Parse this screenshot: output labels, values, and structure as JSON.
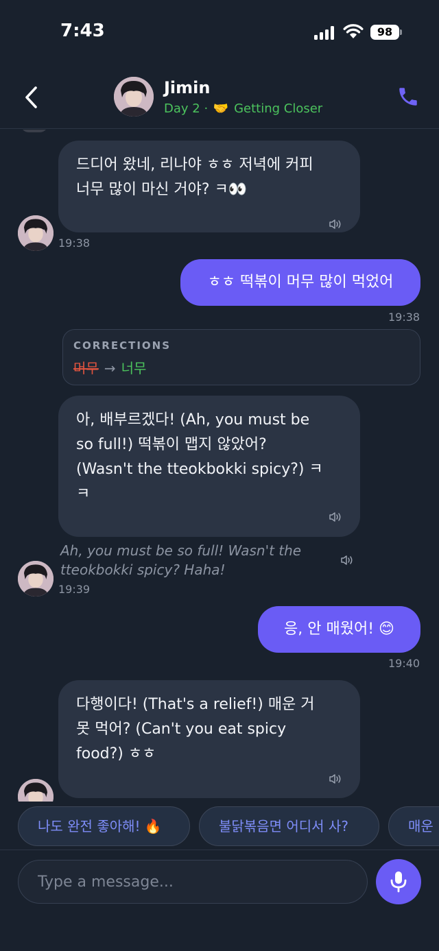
{
  "status": {
    "time": "7:43",
    "battery": "98"
  },
  "header": {
    "name": "Jimin",
    "day": "Day 2 ·",
    "handshake": "🤝",
    "stage": "Getting Closer"
  },
  "messages": [
    {
      "id": "m1",
      "type": "incoming",
      "lines": [
        "드디어 왔네, 리나야 ㅎㅎ 저녁에 커피",
        "너무 많이 마신 거야? ㅋ👀"
      ],
      "time": "19:38"
    },
    {
      "id": "m2",
      "type": "outgoing",
      "text": "ㅎㅎ 떡볶이 머무 많이 먹었어",
      "time": "19:38"
    },
    {
      "id": "m3",
      "type": "corrections",
      "title": "CORRECTIONS",
      "wrong": "머무",
      "arrow": "→",
      "right": "너무"
    },
    {
      "id": "m4",
      "type": "incoming",
      "lines": [
        "아, 배부르겠다! (Ah, you must be",
        "so full!) 떡볶이 맵지 않았어?",
        "(Wasn't the tteokbokki spicy?) ㅋ",
        "ㅋ"
      ],
      "translation": [
        "Ah, you must be so full! Wasn't the",
        "tteokbokki spicy? Haha!"
      ],
      "time": "19:39"
    },
    {
      "id": "m5",
      "type": "outgoing",
      "text": "응, 안 매웠어! 😊",
      "time": "19:40"
    },
    {
      "id": "m6",
      "type": "incoming",
      "lines": [
        "다행이다! (That's a relief!) 매운 거",
        "못 먹어? (Can't you eat spicy",
        "food?) ㅎㅎ"
      ]
    }
  ],
  "suggestions": [
    "나도 완전 좋아해! 🔥",
    "불닭볶음면 어디서 사?",
    "매운"
  ],
  "input": {
    "placeholder": "Type a message..."
  },
  "colors": {
    "background": "#19212d",
    "incoming_bubble": "#2b3444",
    "outgoing_bubble": "#6a5cf5",
    "accent_green": "#4cc35d",
    "correction_red": "#e0543f",
    "chip_text": "#7e8df8"
  },
  "icons": {
    "back": "chevron-left-icon",
    "call": "phone-icon",
    "speaker": "speaker-icon",
    "mic": "microphone-icon",
    "signal": "signal-icon",
    "wifi": "wifi-icon"
  }
}
